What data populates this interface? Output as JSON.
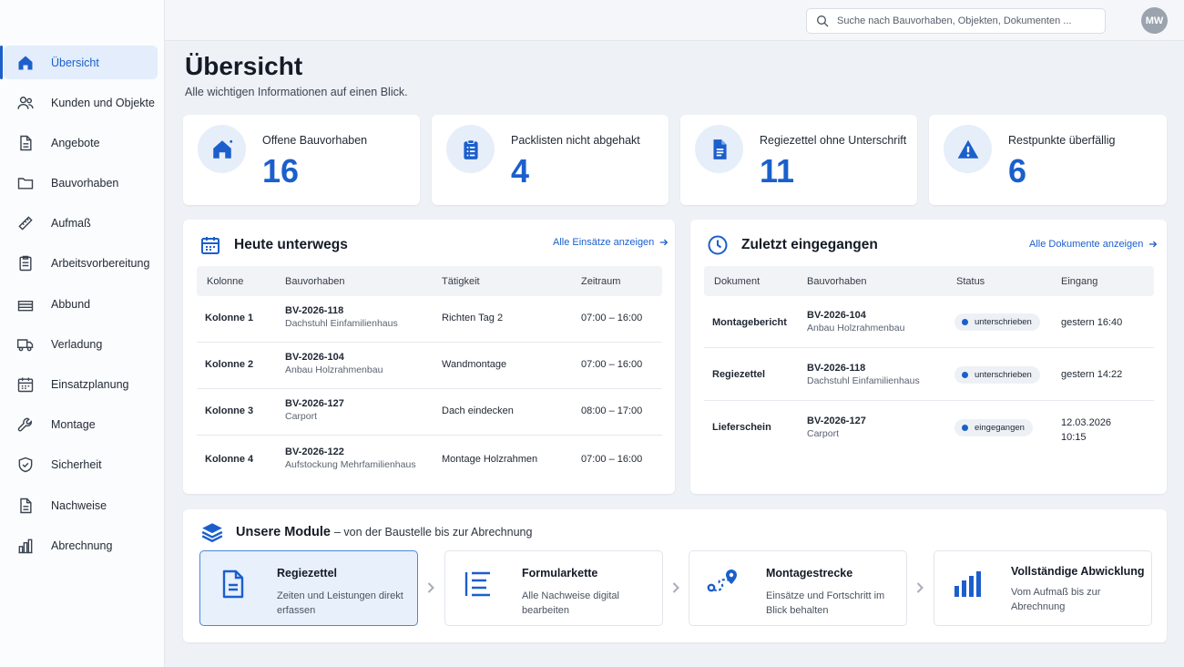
{
  "sidebar": {
    "items": [
      {
        "label": "Übersicht",
        "icon": "home-icon"
      },
      {
        "label": "Kunden und Objekte",
        "icon": "users-icon"
      },
      {
        "label": "Angebote",
        "icon": "document-icon"
      },
      {
        "label": "Bauvorhaben",
        "icon": "folder-icon"
      },
      {
        "label": "Aufmaß",
        "icon": "ruler-icon"
      },
      {
        "label": "Arbeitsvorbereitung",
        "icon": "clipboard-icon"
      },
      {
        "label": "Abbund",
        "icon": "layers-icon"
      },
      {
        "label": "Verladung",
        "icon": "truck-icon"
      },
      {
        "label": "Einsatzplanung",
        "icon": "calendar-icon"
      },
      {
        "label": "Montage",
        "icon": "wrench-icon"
      },
      {
        "label": "Sicherheit",
        "icon": "shield-icon"
      },
      {
        "label": "Nachweise",
        "icon": "document-icon"
      },
      {
        "label": "Abrechnung",
        "icon": "bar-chart-icon"
      }
    ]
  },
  "topbar": {
    "search_placeholder": "Suche nach Bauvorhaben, Objekten, Dokumenten ...",
    "avatar_initials": "MW"
  },
  "page": {
    "title": "Übersicht",
    "subtitle": "Alle wichtigen Informationen auf einen Blick."
  },
  "stats": [
    {
      "label": "Offene Bauvorhaben",
      "value": "16",
      "icon": "home-icon"
    },
    {
      "label": "Packlisten nicht abgehakt",
      "value": "4",
      "icon": "clipboard-icon"
    },
    {
      "label": "Regiezettel ohne Unterschrift",
      "value": "11",
      "icon": "document-icon"
    },
    {
      "label": "Restpunkte überfällig",
      "value": "6",
      "icon": "warning-icon"
    }
  ],
  "today": {
    "title": "Heute unterwegs",
    "link": "Alle Einsätze anzeigen",
    "columns": [
      "Kolonne",
      "Bauvorhaben",
      "Tätigkeit",
      "Zeitraum"
    ],
    "rows": [
      {
        "kolonne": "Kolonne 1",
        "bv": "BV-2026-118",
        "bv_sub": "Dachstuhl Einfamilienhaus",
        "taetigkeit": "Richten Tag 2",
        "zeit": "07:00 – 16:00"
      },
      {
        "kolonne": "Kolonne 2",
        "bv": "BV-2026-104",
        "bv_sub": "Anbau Holzrahmenbau",
        "taetigkeit": "Wandmontage",
        "zeit": "07:00 – 16:00"
      },
      {
        "kolonne": "Kolonne 3",
        "bv": "BV-2026-127",
        "bv_sub": "Carport",
        "taetigkeit": "Dach eindecken",
        "zeit": "08:00 – 17:00"
      },
      {
        "kolonne": "Kolonne 4",
        "bv": "BV-2026-122",
        "bv_sub": "Aufstockung Mehrfamilienhaus",
        "taetigkeit": "Montage Holzrahmen",
        "zeit": "07:00 – 16:00"
      }
    ]
  },
  "recent": {
    "title": "Zuletzt eingegangen",
    "link": "Alle Dokumente anzeigen",
    "columns": [
      "Dokument",
      "Bauvorhaben",
      "Status",
      "Eingang"
    ],
    "rows": [
      {
        "dokument": "Montagebericht",
        "bv": "BV-2026-104",
        "bv_sub": "Anbau Holzrahmenbau",
        "status": "unterschrieben",
        "eingang": "gestern 16:40"
      },
      {
        "dokument": "Regiezettel",
        "bv": "BV-2026-118",
        "bv_sub": "Dachstuhl Einfamilienhaus",
        "status": "unterschrieben",
        "eingang": "gestern 14:22"
      },
      {
        "dokument": "Lieferschein",
        "bv": "BV-2026-127",
        "bv_sub": "Carport",
        "status": "eingegangen",
        "eingang": "12.03.2026",
        "eingang_2": "10:15"
      }
    ]
  },
  "modules": {
    "title": "Unsere Module",
    "subtitle": "– von der Baustelle bis zur Abrechnung",
    "items": [
      {
        "title": "Regiezettel",
        "desc": "Zeiten und Leistungen direkt erfassen",
        "icon": "document-icon"
      },
      {
        "title": "Formularkette",
        "desc": "Alle Nachweise digital bearbeiten",
        "icon": "list-icon"
      },
      {
        "title": "Montagestrecke",
        "desc": "Einsätze und Fortschritt im Blick behalten",
        "icon": "route-icon"
      },
      {
        "title": "Vollständige Abwicklung",
        "desc": "Vom Aufmaß bis zur Abrechnung",
        "icon": "bar-chart-icon"
      }
    ]
  },
  "colors": {
    "accent": "#1b5fcc",
    "accent_light": "#e3edfb",
    "background": "#eef1f5"
  }
}
